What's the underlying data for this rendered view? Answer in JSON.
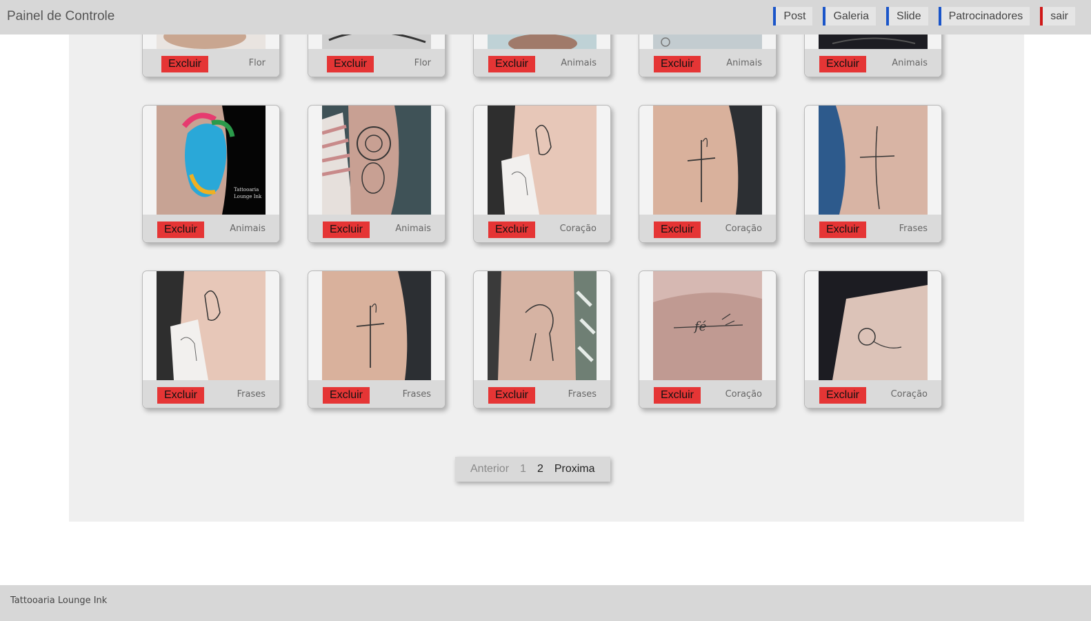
{
  "header": {
    "title": "Painel de Controle",
    "nav": [
      "Post",
      "Galeria",
      "Slide",
      "Patrocinadores",
      "sair"
    ]
  },
  "gallery": {
    "delete_label": "Excluir",
    "rows": [
      [
        "Flor",
        "Flor",
        "Animais",
        "Animais",
        "Animais"
      ],
      [
        "Animais",
        "Animais",
        "Coração",
        "Coração",
        "Frases"
      ],
      [
        "Frases",
        "Frases",
        "Frases",
        "Coração",
        "Coração"
      ]
    ]
  },
  "pagination": {
    "prev": "Anterior",
    "pages": [
      "1",
      "2"
    ],
    "next": "Proxima"
  },
  "footer": {
    "text": "Tattooaria Lounge Ink"
  },
  "colors": {
    "delete_button": "#e53535",
    "nav_accent": "#1a55c9",
    "logout_accent": "#d01818"
  }
}
